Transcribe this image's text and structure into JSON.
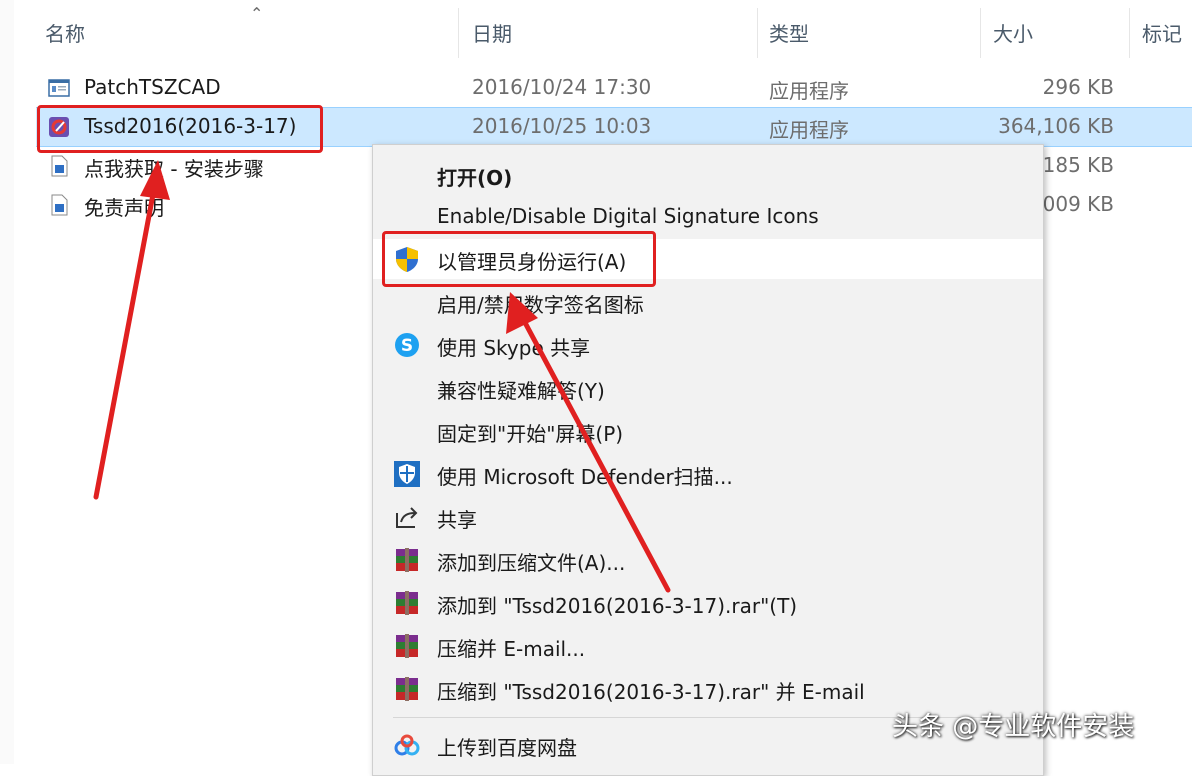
{
  "columns": {
    "name": "名称",
    "date": "日期",
    "type": "类型",
    "size": "大小",
    "tags": "标记"
  },
  "files": [
    {
      "name": "PatchTSZCAD",
      "date": "2016/10/24 17:30",
      "type": "应用程序",
      "size": "296 KB",
      "icon": "exe-window-icon"
    },
    {
      "name": "Tssd2016(2016-3-17)",
      "date": "2016/10/25 10:03",
      "type": "应用程序",
      "size": "364,106 KB",
      "icon": "tssd-app-icon"
    },
    {
      "name": "点我获取 - 安装步骤",
      "date": "",
      "type": "",
      "size": "185 KB",
      "icon": "image-file-icon"
    },
    {
      "name": "免责声明",
      "date": "",
      "type": "",
      "size": "009 KB",
      "icon": "image-file-icon"
    }
  ],
  "context_menu": {
    "items": [
      {
        "label": "打开(O)",
        "icon": ""
      },
      {
        "label": "Enable/Disable Digital Signature Icons",
        "icon": ""
      },
      {
        "label": "以管理员身份运行(A)",
        "icon": "uac-shield-icon"
      },
      {
        "label": "启用/禁用数字签名图标",
        "icon": ""
      },
      {
        "label": "使用 Skype 共享",
        "icon": "skype-icon"
      },
      {
        "label": "兼容性疑难解答(Y)",
        "icon": ""
      },
      {
        "label": "固定到\"开始\"屏幕(P)",
        "icon": ""
      },
      {
        "label": "使用 Microsoft Defender扫描...",
        "icon": "defender-icon"
      },
      {
        "label": "共享",
        "icon": "share-icon"
      },
      {
        "label": "添加到压缩文件(A)...",
        "icon": "winrar-icon"
      },
      {
        "label": "添加到 \"Tssd2016(2016-3-17).rar\"(T)",
        "icon": "winrar-icon"
      },
      {
        "label": "压缩并 E-mail...",
        "icon": "winrar-icon"
      },
      {
        "label": "压缩到 \"Tssd2016(2016-3-17).rar\" 并 E-mail",
        "icon": "winrar-icon"
      },
      {
        "label": "上传到百度网盘",
        "icon": "baidu-netdisk-icon"
      }
    ]
  },
  "watermark": "头条 @专业软件安装",
  "colors": {
    "selection": "#cce8ff",
    "annotation_red": "#e02020",
    "menu_bg": "#f2f2f2"
  }
}
